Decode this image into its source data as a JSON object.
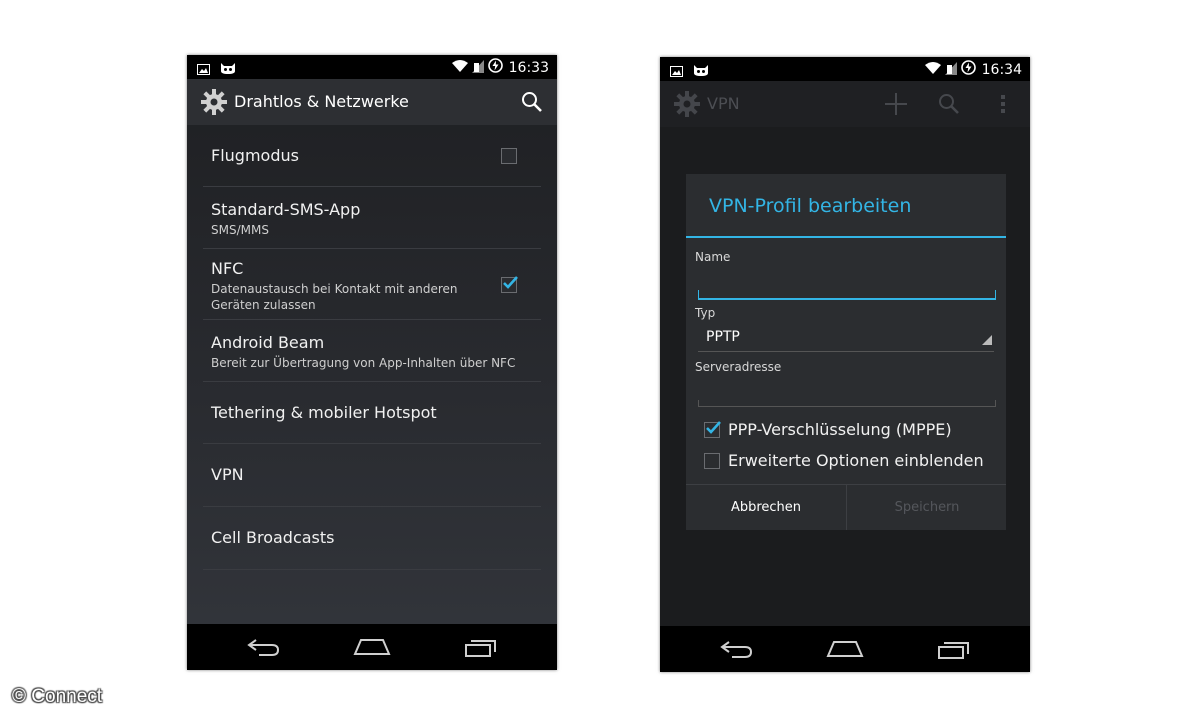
{
  "left_screen": {
    "status_time": "16:33",
    "title": "Drahtlos & Netzwerke",
    "items": [
      {
        "title": "Flugmodus",
        "subtitle": "",
        "checkbox": "unchecked"
      },
      {
        "title": "Standard-SMS-App",
        "subtitle": "SMS/MMS"
      },
      {
        "title": "NFC",
        "subtitle": "Datenaustausch bei Kontakt mit anderen Geräten zulassen",
        "checkbox": "checked"
      },
      {
        "title": "Android Beam",
        "subtitle": "Bereit zur Übertragung von App-Inhalten über NFC"
      },
      {
        "title": "Tethering & mobiler Hotspot",
        "subtitle": ""
      },
      {
        "title": "VPN",
        "subtitle": ""
      },
      {
        "title": "Cell Broadcasts",
        "subtitle": ""
      }
    ]
  },
  "right_screen": {
    "status_time": "16:34",
    "title": "VPN",
    "dialog": {
      "title": "VPN-Profil bearbeiten",
      "name_label": "Name",
      "name_value": "",
      "type_label": "Typ",
      "type_value": "PPTP",
      "server_label": "Serveradresse",
      "server_value": "",
      "mppe_label": "PPP-Verschlüsselung (MPPE)",
      "mppe_checked": true,
      "advanced_label": "Erweiterte Optionen einblenden",
      "advanced_checked": false,
      "cancel_label": "Abbrechen",
      "save_label": "Speichern"
    }
  },
  "copyright": "© Connect",
  "colors": {
    "accent": "#33b5e5",
    "statusbar": "#000000",
    "actionbar": "#2d2f33"
  }
}
